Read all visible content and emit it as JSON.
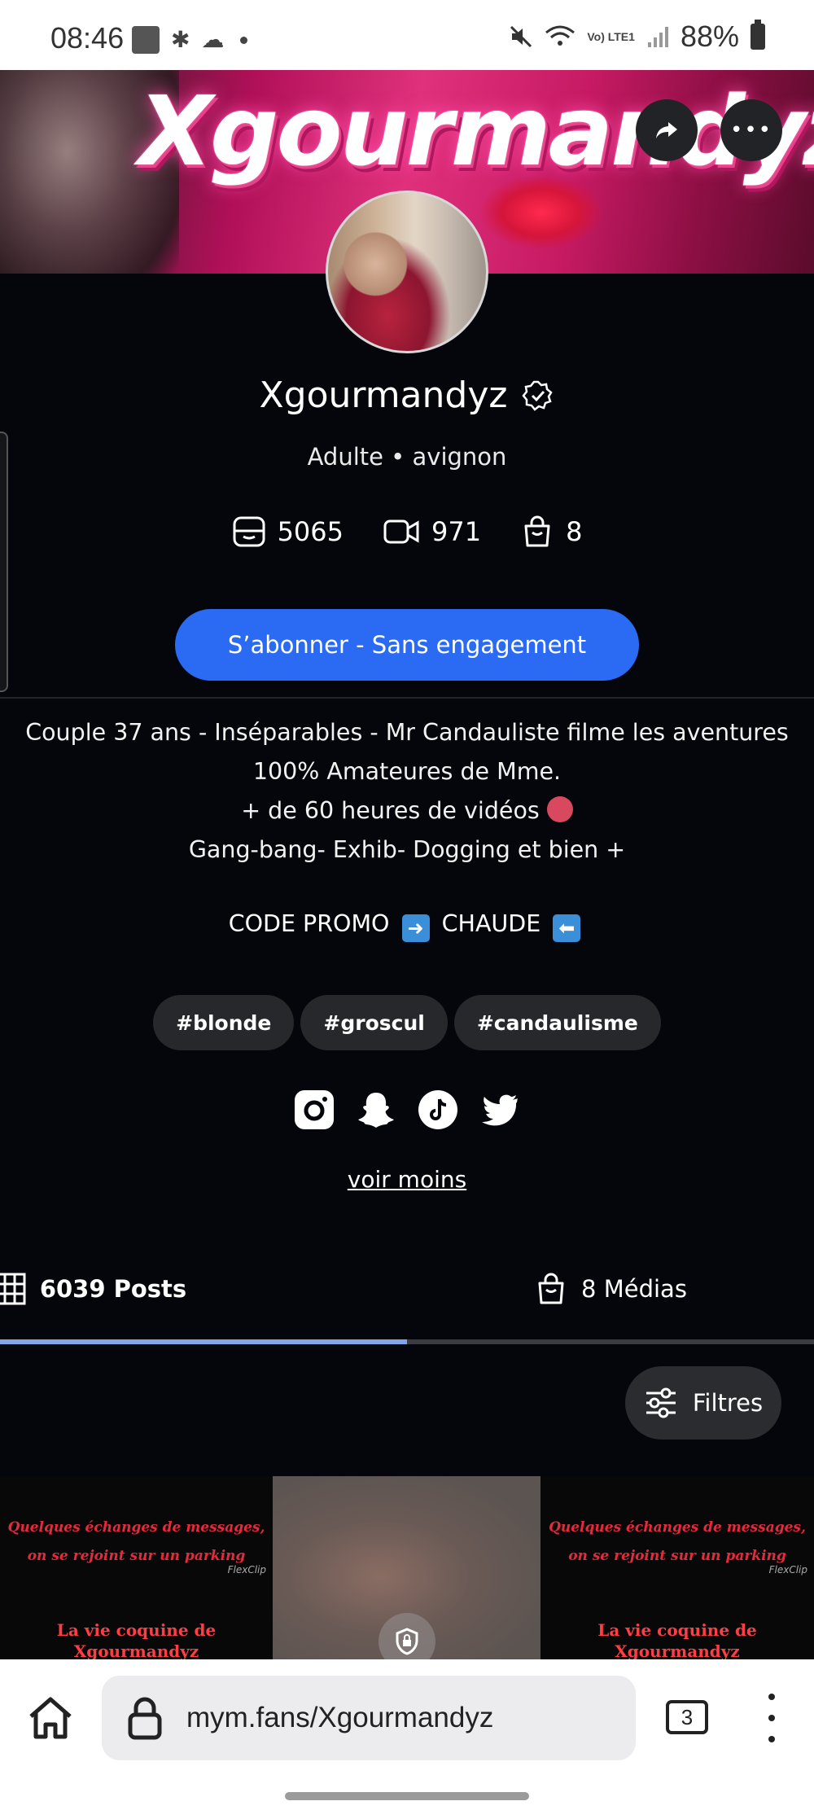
{
  "status_bar": {
    "time": "08:46",
    "battery": "88%",
    "network": "Vo) LTE1"
  },
  "banner": {
    "logo_text": "Xgourmandyz"
  },
  "profile": {
    "name": "Xgourmandyz",
    "subtitle": "Adulte • avignon",
    "stats": {
      "posts": "5065",
      "videos": "971",
      "medias": "8"
    },
    "subscribe_label": "S’abonner - Sans engagement",
    "bio_lines": [
      "Couple 37 ans - Inséparables - Mr Candauliste filme les aventures",
      "100% Amateures de Mme.",
      "+ de 60 heures de vidéos",
      "Gang-bang- Exhib- Dogging et bien +"
    ],
    "promo": {
      "prefix": "CODE PROMO",
      "code": "CHAUDE"
    },
    "tags": [
      "#blonde",
      "#groscul",
      "#candaulisme"
    ],
    "socials": [
      "instagram-icon",
      "snapchat-icon",
      "tiktok-icon",
      "twitter-icon"
    ],
    "voir_moins": "voir moins"
  },
  "tabs": {
    "posts_label": "6039 Posts",
    "medias_label": "8 Médias",
    "active": "posts"
  },
  "filters_label": "Filtres",
  "grid": {
    "tile1_caption": "Quelques échanges de messages, on se rejoint sur un parking",
    "tile1_title": "La vie coquine de Xgourmandyz",
    "tile1_brand": "FlexClip",
    "tile3_caption": "Quelques échanges de messages, on se rejoint sur un parking",
    "tile3_title": "La vie coquine de Xgourmandyz",
    "tile3_brand": "FlexClip"
  },
  "browser": {
    "url": "mym.fans/Xgourmandyz",
    "tab_count": "3"
  }
}
